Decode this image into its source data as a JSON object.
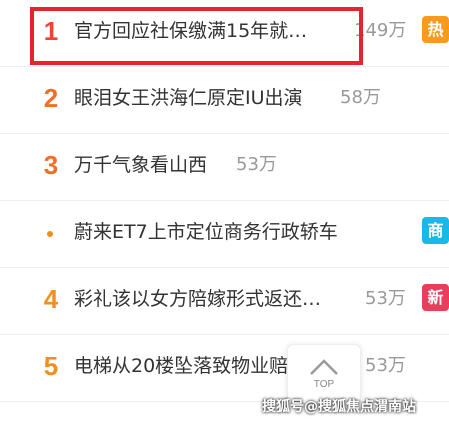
{
  "colors": {
    "rank_top": "#f0442e",
    "rank_mid": "#f07028",
    "rank_low": "#f08f1e",
    "dot": "#f08f1e",
    "badge_hot": "#f79a1e",
    "badge_business": "#1ab8e8",
    "badge_new": "#ea3d5c",
    "highlight": "#e8232e"
  },
  "items": [
    {
      "rank": "1",
      "title": "官方回应社保缴满15年就…",
      "count": "149万",
      "badge": "热",
      "badge_icon": "hot-badge"
    },
    {
      "rank": "2",
      "title": "眼泪女王洪海仁原定IU出演",
      "count": "58万",
      "badge": "",
      "badge_icon": ""
    },
    {
      "rank": "3",
      "title": "万千气象看山西",
      "count": "53万",
      "badge": "",
      "badge_icon": ""
    },
    {
      "rank": "",
      "title": "蔚来ET7上市定位商务行政轿车",
      "count": "",
      "badge": "商",
      "badge_icon": "business-badge"
    },
    {
      "rank": "4",
      "title": "彩礼该以女方陪嫁形式返还…",
      "count": "53万",
      "badge": "新",
      "badge_icon": "new-badge"
    },
    {
      "rank": "5",
      "title": "电梯从20楼坠落致物业赔",
      "count": "53万",
      "badge": "",
      "badge_icon": ""
    }
  ],
  "back_to_top": {
    "label": "TOP",
    "icon": "chevron-up-icon"
  },
  "watermark": "搜狐号@搜狐焦点渭南站"
}
